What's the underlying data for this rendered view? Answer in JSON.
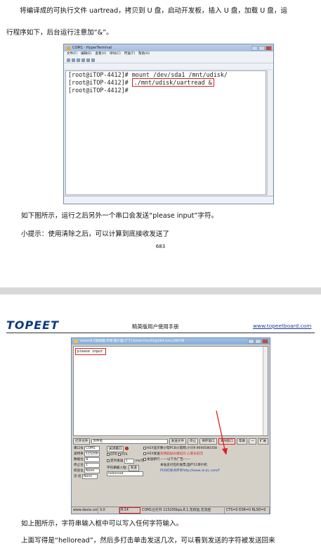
{
  "page1": {
    "para1_line1": "将编译成的可执行文件 uartread，拷贝到 U 盘，启动开发板，插入 U 盘，加载 U 盘，运",
    "para1_line2": "行程序如下，后台运行注意加“&”。",
    "terminal": {
      "title": "COM1 - HyperTerminal",
      "menu": [
        "文件(F)",
        "编辑(E)",
        "查看(V)",
        "呼叫(C)",
        "传送(T)",
        "帮助(H)"
      ],
      "tab": "COM1",
      "lines": [
        "[root@iTOP-4412]# mount /dev/sda1 /mnt/udisk/",
        "[root@iTOP-4412]# ",
        "[root@iTOP-4412]# "
      ],
      "highlight_cmd": "./mnt/udisk/uartread &"
    },
    "para2": "如下图所示，运行之后另外一个串口会发送“please input”字符。",
    "para3": "小提示：使用清除之后，可以计算到底接收发送了",
    "page_number": "683"
  },
  "page2": {
    "logo": "TOPEET",
    "header_title": "精英版用户使用手册",
    "header_link": "www.topeetboard.com",
    "serial": {
      "title": "sscom4.2测试版,作者:聂小猛(丁丁),Email:mcu52@163.com,2007/8",
      "received": "please input",
      "row1": {
        "open_file": "打开文件",
        "filename_label": "文件名",
        "send_file": "发送文件",
        "stop": "停止",
        "save_window": "保存窗口",
        "clear_window": "清除窗口",
        "help": "帮助",
        "minus": "一",
        "expand": "扩展"
      },
      "port_label": "串口号",
      "port_value": "COM1",
      "baud_label": "波特率",
      "baud_value": "115200",
      "databits_label": "数据位",
      "databits_value": "8",
      "stopbits_label": "停止位",
      "stopbits_value": "1",
      "parity_label": "校验位",
      "parity_value": "None",
      "flow_label": "流 控",
      "flow_value": "None",
      "close_port": "关闭串口",
      "dtr": "DTR",
      "rts": "RTS",
      "hex_display": "HEX显示",
      "hex_send": "HEX发送",
      "send_newline": "发送新行",
      "timed_send": "定时发送",
      "period": "1",
      "period_unit": "ms/次",
      "char_input": "字符串输入框:",
      "send": "发送",
      "input_value": "helloread",
      "promo1": "欢迎使用专业串口调试工具SSCOM !",
      "promo2": "作者:聂小猛(丁丁)",
      "promo3": "最新版本下载地址:",
      "promo_red": "数小帮PCB火箭网,小只9.9000580358",
      "promo_blue": "双钥匙加长版纪元·心变长纪元",
      "promo_line": "------以下为广告------",
      "promo_web": "PCB打样点评享http://www.sz-jlc.com/f",
      "promo_ad": "本站支付包的发票,国产51单片机",
      "status_web": "www.daxia.com",
      "status_s": "S:0",
      "status_r": "R:14",
      "status_port": "COM1已打开  115200bps,8,1,无校验,无流控",
      "status_lines": "CTS=0 DSR=0 RLSD=0"
    },
    "para1": "如上图所示，字符串输入框中可以写入任何字符输入。",
    "para2": "上面写得是“helloread”，然后多打击单击发送几次，可以看到发送的字符被发送回来"
  }
}
